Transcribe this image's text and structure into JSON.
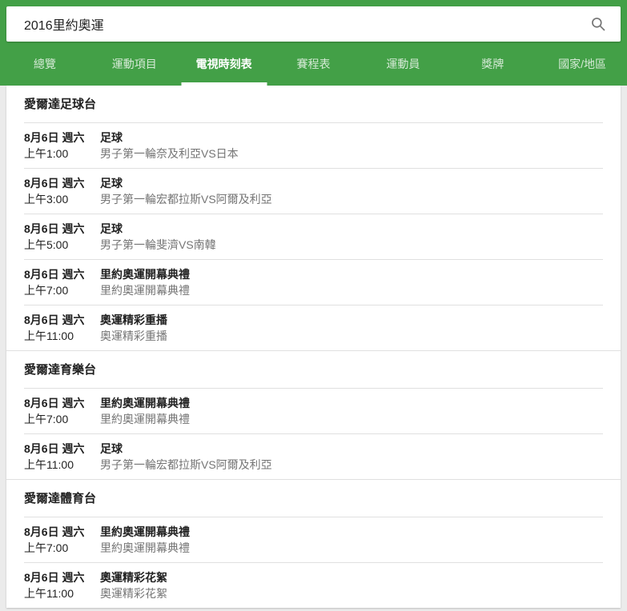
{
  "colors": {
    "brand_green": "#43A047",
    "page_background": "#ebebeb",
    "divider": "#e0e0e0",
    "primary_text": "#212121",
    "secondary_text": "#757575",
    "active_tab_indicator": "#ffffff"
  },
  "search": {
    "query": "2016里約奧運",
    "icon": "search-icon"
  },
  "tabs": [
    {
      "label": "總覽",
      "active": false
    },
    {
      "label": "運動項目",
      "active": false
    },
    {
      "label": "電視時刻表",
      "active": true
    },
    {
      "label": "賽程表",
      "active": false
    },
    {
      "label": "運動員",
      "active": false
    },
    {
      "label": "獎牌",
      "active": false
    },
    {
      "label": "國家/地區",
      "active": false
    }
  ],
  "sections": [
    {
      "title": "愛爾達足球台",
      "rows": [
        {
          "date": "8月6日 週六",
          "time": "上午1:00",
          "title": "足球",
          "subtitle": "男子第一輪奈及利亞VS日本"
        },
        {
          "date": "8月6日 週六",
          "time": "上午3:00",
          "title": "足球",
          "subtitle": "男子第一輪宏都拉斯VS阿爾及利亞"
        },
        {
          "date": "8月6日 週六",
          "time": "上午5:00",
          "title": "足球",
          "subtitle": "男子第一輪斐濟VS南韓"
        },
        {
          "date": "8月6日 週六",
          "time": "上午7:00",
          "title": "里約奧運開幕典禮",
          "subtitle": "里約奧運開幕典禮"
        },
        {
          "date": "8月6日 週六",
          "time": "上午11:00",
          "title": "奧運精彩重播",
          "subtitle": "奧運精彩重播"
        }
      ]
    },
    {
      "title": "愛爾達育樂台",
      "rows": [
        {
          "date": "8月6日 週六",
          "time": "上午7:00",
          "title": "里約奧運開幕典禮",
          "subtitle": "里約奧運開幕典禮"
        },
        {
          "date": "8月6日 週六",
          "time": "上午11:00",
          "title": "足球",
          "subtitle": "男子第一輪宏都拉斯VS阿爾及利亞"
        }
      ]
    },
    {
      "title": "愛爾達體育台",
      "rows": [
        {
          "date": "8月6日 週六",
          "time": "上午7:00",
          "title": "里約奧運開幕典禮",
          "subtitle": "里約奧運開幕典禮"
        },
        {
          "date": "8月6日 週六",
          "time": "上午11:00",
          "title": "奧運精彩花絮",
          "subtitle": "奧運精彩花絮"
        }
      ]
    }
  ]
}
